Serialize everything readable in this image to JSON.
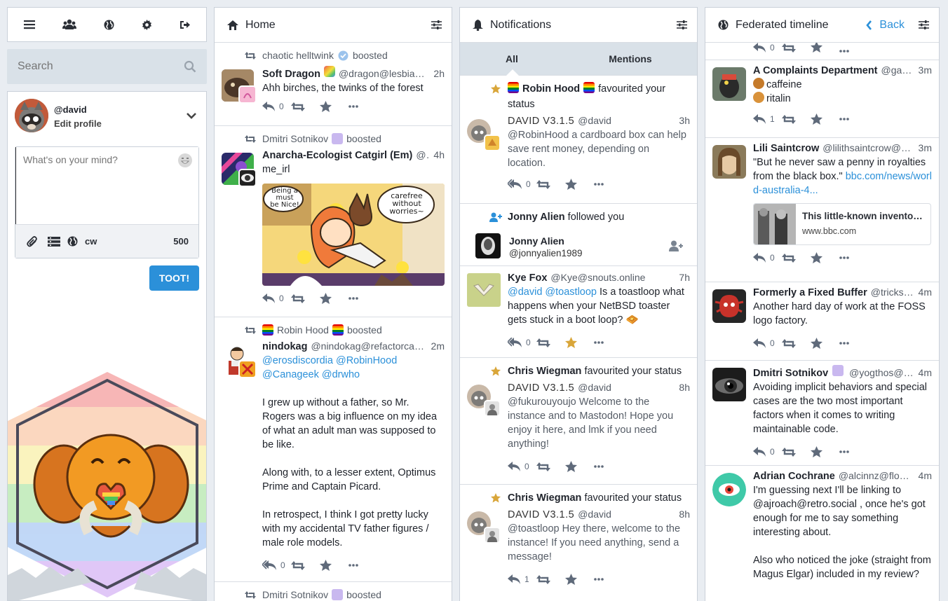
{
  "nav": {
    "icons": [
      "menu-icon",
      "community-icon",
      "globe-icon",
      "gear-icon",
      "logout-icon"
    ]
  },
  "search": {
    "placeholder": "Search"
  },
  "profile": {
    "handle": "@david",
    "edit": "Edit profile"
  },
  "compose": {
    "placeholder": "What's on your mind?",
    "cw": "cw",
    "count": "500",
    "toot": "TOOT!"
  },
  "home": {
    "title": "Home",
    "statuses": [
      {
        "booster": "chaotic helltwink",
        "boosted": "boosted",
        "name": "Soft Dragon",
        "acct": "@dragon@lesbian....",
        "time": "2h",
        "text": "Ahh birches, the twinks of the forest",
        "replies": "0"
      },
      {
        "booster": "Dmitri Sotnikov",
        "boosted": "boosted",
        "name": "Anarcha-Ecologist Catgirl (Em)",
        "acct": "@...",
        "time": "4h",
        "text": "me_irl",
        "replies": "0",
        "comic": [
          "Being a",
          "must",
          "be Nice!",
          "carefree",
          "without",
          "worries~"
        ]
      },
      {
        "booster": "Robin Hood",
        "boosted": "boosted",
        "name": "nindokag",
        "acct": "@nindokag@refactorcam...",
        "time": "2m",
        "mentions": "@erosdiscordia @RobinHood @Canageek @drwho",
        "p1": "I grew up without a father, so Mr. Rogers was a big influence on my idea of what an adult man was supposed to be like.",
        "p2": "Along with, to a lesser extent, Optimus Prime and Captain Picard.",
        "p3": "In retrospect, I think I got pretty lucky with my accidental TV father figures / male role models.",
        "replies": "0"
      },
      {
        "booster": "Dmitri Sotnikov",
        "boosted": "boosted"
      }
    ]
  },
  "notifications": {
    "title": "Notifications",
    "tabs": [
      "All",
      "Mentions"
    ],
    "items": [
      {
        "actor": "Robin Hood",
        "verb": "favourited your status",
        "name": "DAVID V3.1.5",
        "acct": "@david",
        "time": "3h",
        "text": "@RobinHood a cardboard box can help save rent money, depending on location.",
        "replies": "0"
      },
      {
        "actor": "Jonny Alien",
        "verb": "followed you",
        "name": "Jonny Alien",
        "acct": "@jonnyalien1989"
      },
      {
        "name": "Kye Fox",
        "acct": "@Kye@snouts.online",
        "time": "7h",
        "mentions": "@david @toastloop",
        "text": " Is a toastloop what happens when your NetBSD toaster gets stuck in a boot loop? 🧇",
        "replies": "0"
      },
      {
        "actor": "Chris Wiegman",
        "verb": "favourited your status",
        "name": "DAVID V3.1.5",
        "acct": "@david",
        "time": "8h",
        "text": "@fukurouyoujo Welcome to the instance and to Mastodon! Hope you enjoy it here, and lmk if you need anything!",
        "replies": "0"
      },
      {
        "actor": "Chris Wiegman",
        "verb": "favourited your status",
        "name": "DAVID V3.1.5",
        "acct": "@david",
        "time": "8h",
        "text": "@toastloop Hey there, welcome to the instance! If you need anything, send a message!",
        "replies": "1"
      }
    ]
  },
  "federated": {
    "title": "Federated timeline",
    "back": "Back",
    "top_replies": "0",
    "statuses": [
      {
        "name": "A Complaints Department",
        "acct": "@gatt...",
        "time": "3m",
        "line1": "caffeine",
        "line2": "ritalin",
        "replies": "1"
      },
      {
        "name": "Lili Saintcrow",
        "acct": "@lilithsaintcrow@ra...",
        "time": "3m",
        "text": "\"But he never saw a penny in royalties from the black box.\" ",
        "link": "bbc.com/news/world-australia-4...",
        "card_title": "This little-known inventor ...",
        "card_domain": "www.bbc.com",
        "replies": "0"
      },
      {
        "name": "Formerly a Fixed Buffer",
        "acct": "@trickste...",
        "time": "4m",
        "text": "Another hard day of work at the FOSS logo factory.",
        "replies": "0"
      },
      {
        "name": "Dmitri Sotnikov",
        "acct": "@yogthos@m...",
        "time": "4m",
        "text": "Avoiding implicit behaviors and special cases are the two most important factors when it comes to writing maintainable code.",
        "replies": "0"
      },
      {
        "name": "Adrian Cochrane",
        "acct": "@alcinnz@floss....",
        "time": "4m",
        "text": "I'm guessing next I'll be linking to @ajroach@retro.social , once he's got enough for me to say something interesting about.",
        "text2": "Also who noticed the joke (straight from Magus Elgar) included in my review?"
      }
    ]
  }
}
